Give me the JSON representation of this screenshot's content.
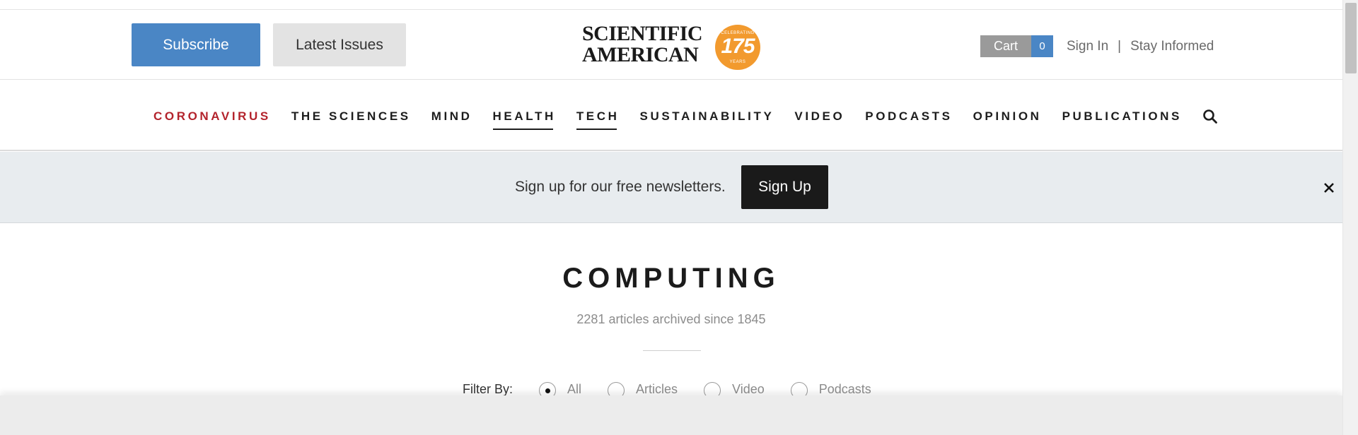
{
  "header": {
    "subscribe_label": "Subscribe",
    "latest_issues_label": "Latest Issues",
    "logo": {
      "line1": "SCIENTIFIC",
      "line2": "AMERICAN",
      "seal_top": "CELEBRATING",
      "seal_number": "175",
      "seal_bottom": "YEARS",
      "seal_color": "#f29a2e"
    },
    "cart": {
      "label": "Cart",
      "count": "0"
    },
    "sign_in": "Sign In",
    "separator": "|",
    "stay_informed": "Stay Informed"
  },
  "nav": {
    "items": [
      {
        "label": "CORONAVIRUS",
        "color": "#b3232c"
      },
      {
        "label": "THE SCIENCES"
      },
      {
        "label": "MIND"
      },
      {
        "label": "HEALTH",
        "underlined": true
      },
      {
        "label": "TECH",
        "underlined": true
      },
      {
        "label": "SUSTAINABILITY"
      },
      {
        "label": "VIDEO"
      },
      {
        "label": "PODCASTS"
      },
      {
        "label": "OPINION"
      },
      {
        "label": "PUBLICATIONS"
      }
    ],
    "search_icon": "search-icon"
  },
  "banner": {
    "text": "Sign up for our free newsletters.",
    "signup_label": "Sign Up",
    "close_icon": "close-icon"
  },
  "section": {
    "title": "COMPUTING",
    "count_text": "2281 articles archived since 1845"
  },
  "filter": {
    "label": "Filter By:",
    "options": [
      {
        "label": "All",
        "checked": true
      },
      {
        "label": "Articles",
        "checked": false
      },
      {
        "label": "Video",
        "checked": false
      },
      {
        "label": "Podcasts",
        "checked": false
      }
    ]
  },
  "colors": {
    "accent_blue": "#4a86c5",
    "banner_bg": "#e8ecef",
    "alert_red": "#b3232c"
  }
}
